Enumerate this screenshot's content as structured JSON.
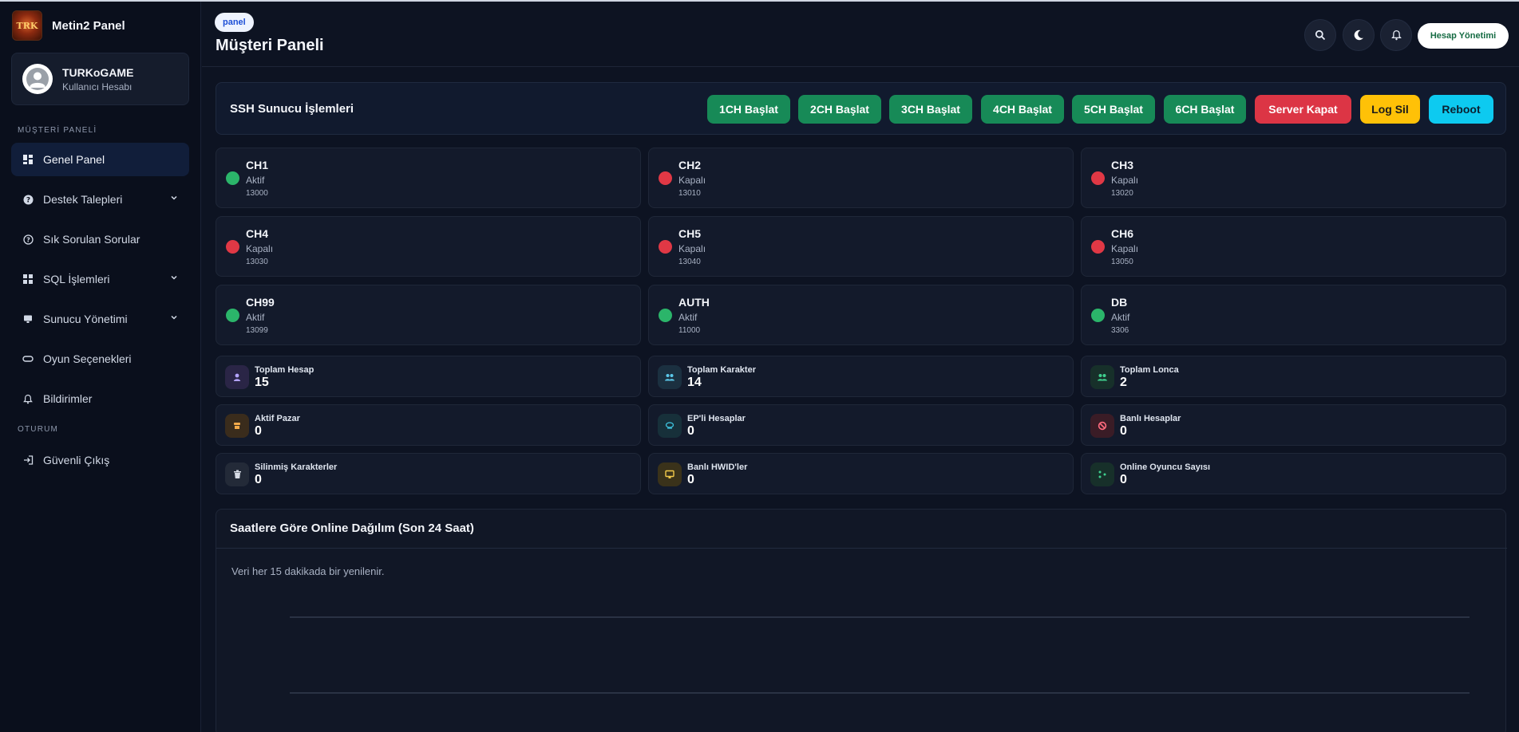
{
  "app": {
    "brand_title": "Metin2 Panel",
    "logo_text": "TRK"
  },
  "user": {
    "name": "TURKoGAME",
    "subtitle": "Kullanıcı Hesabı"
  },
  "sidebar": {
    "section_main": "MÜŞTERİ PANELİ",
    "section_session": "OTURUM",
    "items": [
      {
        "label": "Genel Panel",
        "icon": "dashboard-icon",
        "active": true
      },
      {
        "label": "Destek Talepleri",
        "icon": "help-circle-icon",
        "chevron": true
      },
      {
        "label": "Sık Sorulan Sorular",
        "icon": "question-icon"
      },
      {
        "label": "SQL İşlemleri",
        "icon": "grid-icon",
        "chevron": true
      },
      {
        "label": "Sunucu Yönetimi",
        "icon": "monitor-icon",
        "chevron": true
      },
      {
        "label": "Oyun Seçenekleri",
        "icon": "link-icon"
      },
      {
        "label": "Bildirimler",
        "icon": "bell-icon"
      }
    ],
    "logout_label": "Güvenli Çıkış"
  },
  "header": {
    "breadcrumb": "panel",
    "title": "Müşteri Paneli",
    "account_button": "Hesap Yönetimi"
  },
  "ssh": {
    "title": "SSH Sunucu İşlemleri",
    "buttons": [
      "1CH Başlat",
      "2CH Başlat",
      "3CH Başlat",
      "4CH Başlat",
      "5CH Başlat",
      "6CH Başlat",
      "Server Kapat",
      "Log Sil",
      "Reboot"
    ]
  },
  "channels": [
    {
      "name": "CH1",
      "status": "Aktif",
      "port": "13000",
      "online": true
    },
    {
      "name": "CH2",
      "status": "Kapalı",
      "port": "13010",
      "online": false
    },
    {
      "name": "CH3",
      "status": "Kapalı",
      "port": "13020",
      "online": false
    },
    {
      "name": "CH4",
      "status": "Kapalı",
      "port": "13030",
      "online": false
    },
    {
      "name": "CH5",
      "status": "Kapalı",
      "port": "13040",
      "online": false
    },
    {
      "name": "CH6",
      "status": "Kapalı",
      "port": "13050",
      "online": false
    },
    {
      "name": "CH99",
      "status": "Aktif",
      "port": "13099",
      "online": true
    },
    {
      "name": "AUTH",
      "status": "Aktif",
      "port": "11000",
      "online": true
    },
    {
      "name": "DB",
      "status": "Aktif",
      "port": "3306",
      "online": true
    }
  ],
  "stats": [
    {
      "label": "Toplam Hesap",
      "value": "15"
    },
    {
      "label": "Toplam Karakter",
      "value": "14"
    },
    {
      "label": "Toplam Lonca",
      "value": "2"
    },
    {
      "label": "Aktif Pazar",
      "value": "0"
    },
    {
      "label": "EP'li Hesaplar",
      "value": "0"
    },
    {
      "label": "Banlı Hesaplar",
      "value": "0"
    },
    {
      "label": "Silinmiş Karakterler",
      "value": "0"
    },
    {
      "label": "Banlı HWID'ler",
      "value": "0"
    },
    {
      "label": "Online Oyuncu Sayısı",
      "value": "0"
    }
  ],
  "chart": {
    "title": "Saatlere Göre Online Dağılım (Son 24 Saat)",
    "note": "Veri her 15 dakikada bir yenilenir."
  },
  "colors": {
    "green": "#178a57",
    "red": "#dc3545",
    "yellow": "#ffc107",
    "cyan": "#0dcaf0",
    "status_online": "#2bb56a",
    "status_offline": "#e03845"
  }
}
